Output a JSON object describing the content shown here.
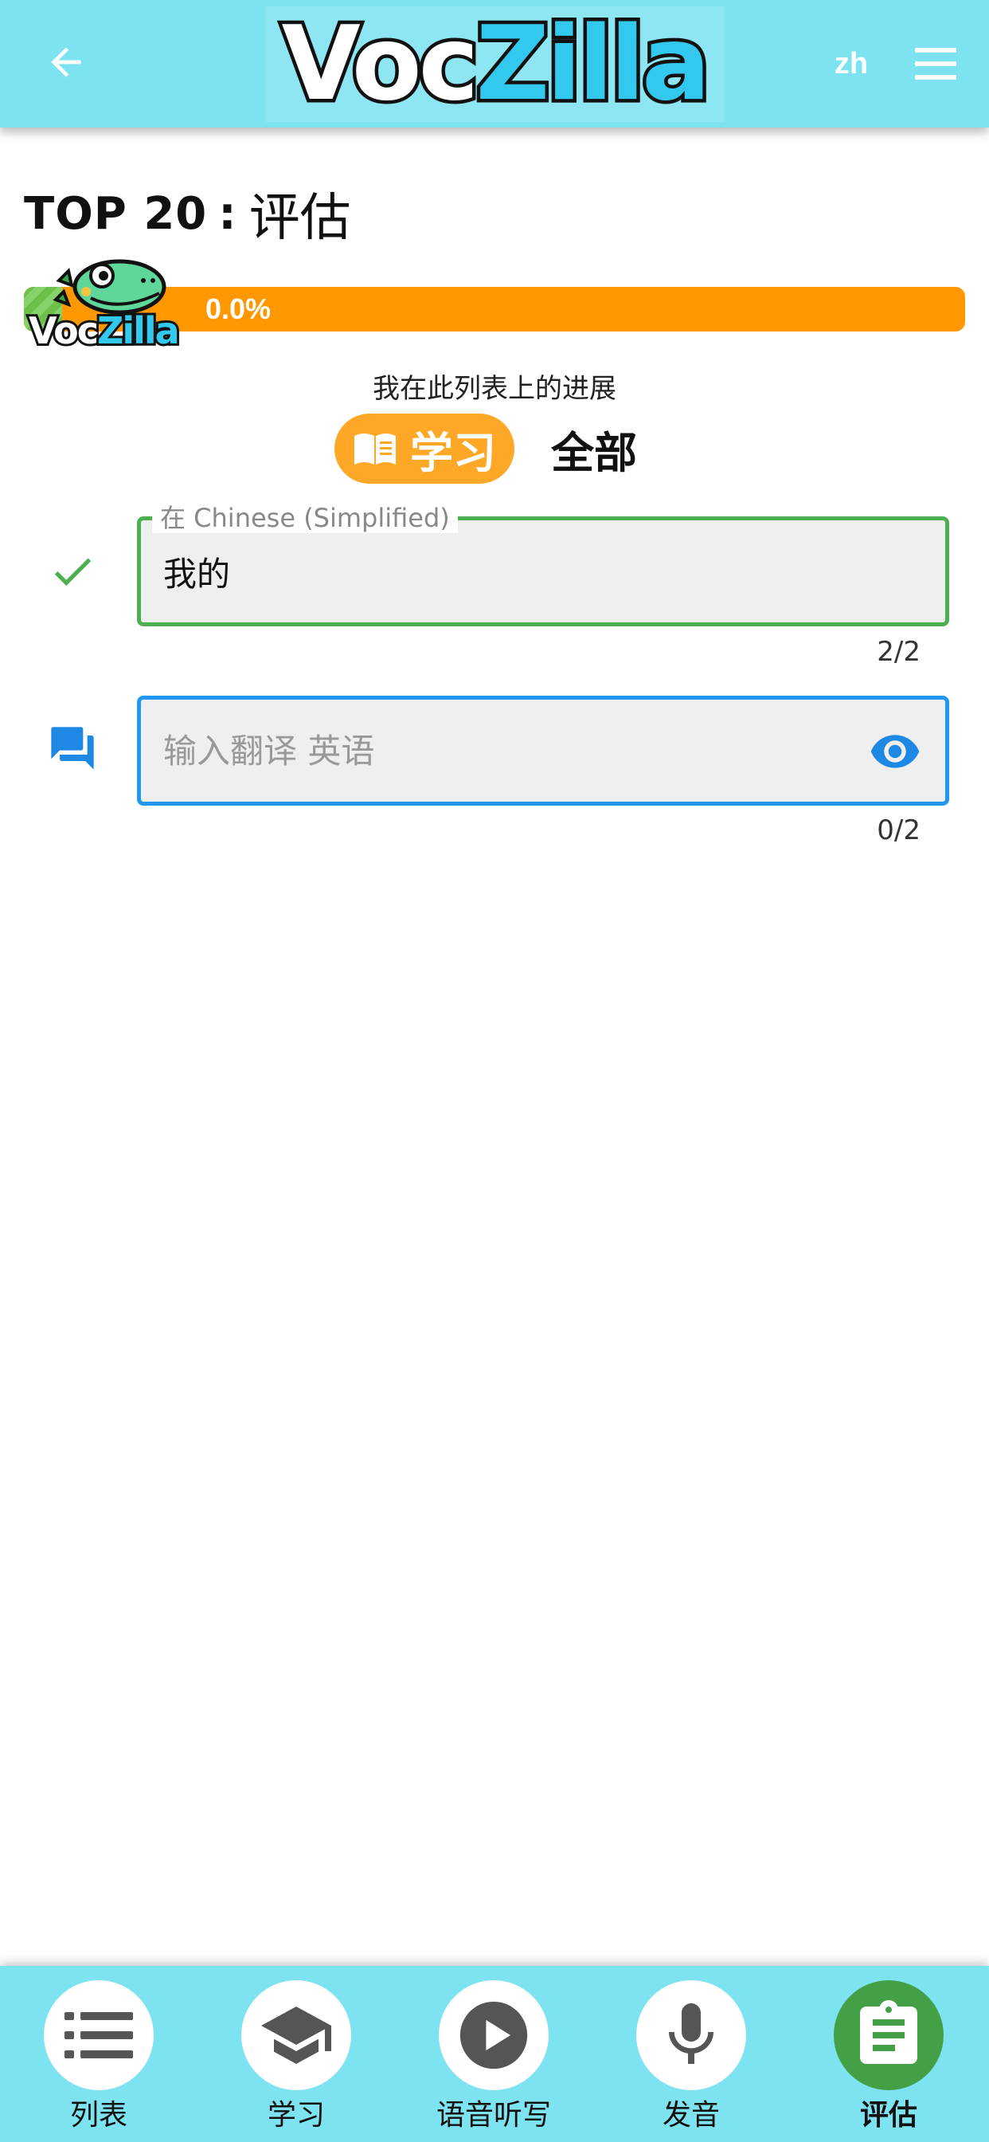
{
  "header": {
    "logo_part1": "Voc",
    "logo_part2": "Zilla",
    "lang": "zh"
  },
  "title": {
    "main": "TOP 20",
    "separator": ":",
    "sub": "评估"
  },
  "progress": {
    "percent_text": "0.0%",
    "value": 0.0,
    "mascot_part1": "Voc",
    "mascot_part2": "Zilla",
    "caption": "我在此列表上的进展"
  },
  "mode": {
    "learn_label": "学习",
    "all_label": "全部"
  },
  "word": {
    "label": "在 Chinese (Simplified)",
    "value": "我的",
    "counter": "2/2"
  },
  "translation": {
    "value": "",
    "placeholder": "输入翻译 英语",
    "counter": "0/2"
  },
  "nav": {
    "items": [
      {
        "label": "列表",
        "icon": "list-icon",
        "active": false
      },
      {
        "label": "学习",
        "icon": "graduation-cap-icon",
        "active": false
      },
      {
        "label": "语音听写",
        "icon": "play-icon",
        "active": false
      },
      {
        "label": "发音",
        "icon": "microphone-icon",
        "active": false
      },
      {
        "label": "评估",
        "icon": "assignment-icon",
        "active": true
      }
    ]
  },
  "colors": {
    "header_bg": "#7ee3f0",
    "progress_bar": "#ff9800",
    "learn_pill": "#ffa726",
    "success_green": "#4caf50",
    "focus_blue": "#2196f3",
    "nav_active": "#43a047"
  }
}
